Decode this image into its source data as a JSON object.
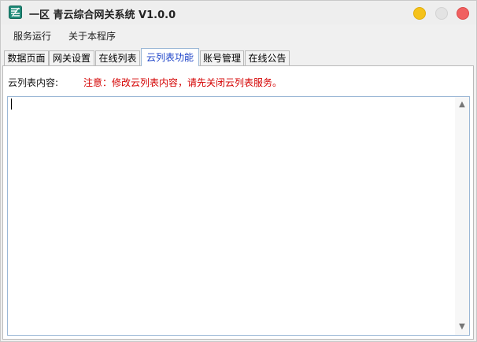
{
  "window": {
    "title": "一区 青云综合网关系统 V1.0.0",
    "app_icon": "app-logo-icon",
    "controls": {
      "minimize": "minimize-icon",
      "maximize": "maximize-icon",
      "close": "close-icon"
    }
  },
  "menubar": {
    "items": [
      "服务运行",
      "关于本程序"
    ]
  },
  "tabs": {
    "items": [
      "数据页面",
      "网关设置",
      "在线列表",
      "云列表功能",
      "账号管理",
      "在线公告"
    ],
    "active": "云列表功能"
  },
  "cloud_list": {
    "content_label": "云列表内容:",
    "warning": "注意：修改云列表内容，请先关闭云列表服务。",
    "editor_value": ""
  },
  "colors": {
    "accent": "#1d43c8",
    "warning": "#d40000",
    "minimize": "#f5c21a",
    "close": "#f06060"
  }
}
